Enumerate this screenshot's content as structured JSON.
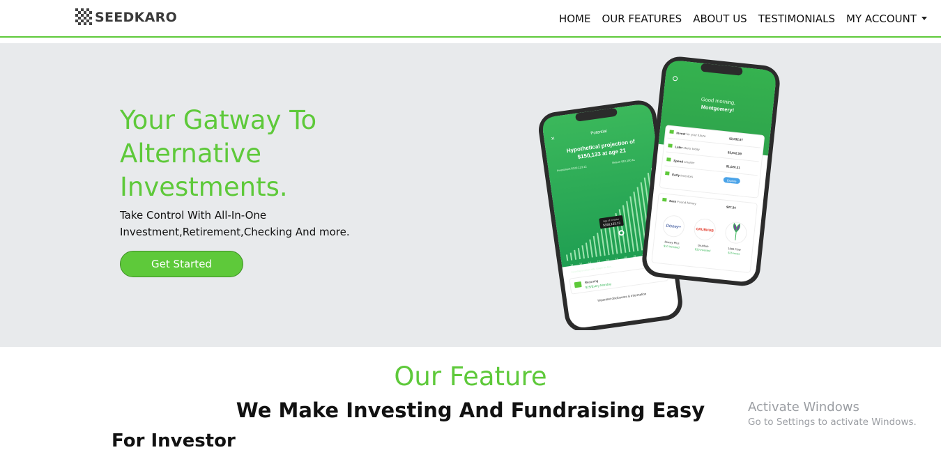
{
  "brand": {
    "name": "SEEDKARO",
    "logo_icon": "checker-square-icon"
  },
  "nav": {
    "items": [
      "HOME",
      "OUR FEATURES",
      "ABOUT US",
      "TESTIMONIALS"
    ],
    "account": "MY ACCOUNT"
  },
  "hero": {
    "title": "Your Gatway To Alternative Investments.",
    "subtitle": "Take Control With All-In-One Investment,Retirement,Checking And more.",
    "cta": "Get Started",
    "phone_back": {
      "header": "Potential",
      "projection_line1": "Hypothetical projection of",
      "projection_line2": "$150,133 at age 21",
      "legend_1": "Investment $129,123.12",
      "legend_2": "Return $10,100.11",
      "tooltip_1": "Age of investor",
      "tooltip_2": "$150,133.13",
      "axis_years": [
        "12",
        "13",
        "14",
        "15",
        "16",
        "17",
        "18",
        "19",
        "20",
        "21",
        "22"
      ],
      "footnote": "Investing involves risk. Graph for illus...",
      "recurring_label": "Recurring",
      "recurring_value": "$25/Every Monday",
      "disclosures": "Important disclosures & information"
    },
    "phone_front": {
      "greeting": "Good morning,",
      "name": "Montgomery!",
      "rows": [
        {
          "label": "Invest",
          "sub": "for your future",
          "value": "$2,032.97"
        },
        {
          "label": "Later",
          "sub": "starts today",
          "value": "$3,942.59"
        },
        {
          "label": "Spend",
          "sub": "smarter",
          "value": "$1,020.31"
        },
        {
          "label": "Early",
          "sub": "investors",
          "value": "Explore"
        }
      ],
      "earn_label": "Earn",
      "earn_sub": "Found Money",
      "earn_value": "$27.34",
      "brands": [
        {
          "name": "Disney Plus",
          "value": "$10 invested",
          "logo": "Disney+"
        },
        {
          "name": "Grubhub",
          "value": "$10 invested",
          "logo": "GRUBHUB"
        },
        {
          "name": "1800 Flow",
          "value": "$15 inves",
          "logo": ""
        }
      ]
    }
  },
  "features": {
    "title": "Our Feature",
    "subtitle": "We Make Investing And Fundraising Easy",
    "investor_heading": "For Investor"
  },
  "watermark": {
    "line1": "Activate Windows",
    "line2": "Go to Settings to activate Windows."
  },
  "colors": {
    "accent": "#5ec93a",
    "hero_bg": "#e8eaec",
    "text": "#111111"
  }
}
